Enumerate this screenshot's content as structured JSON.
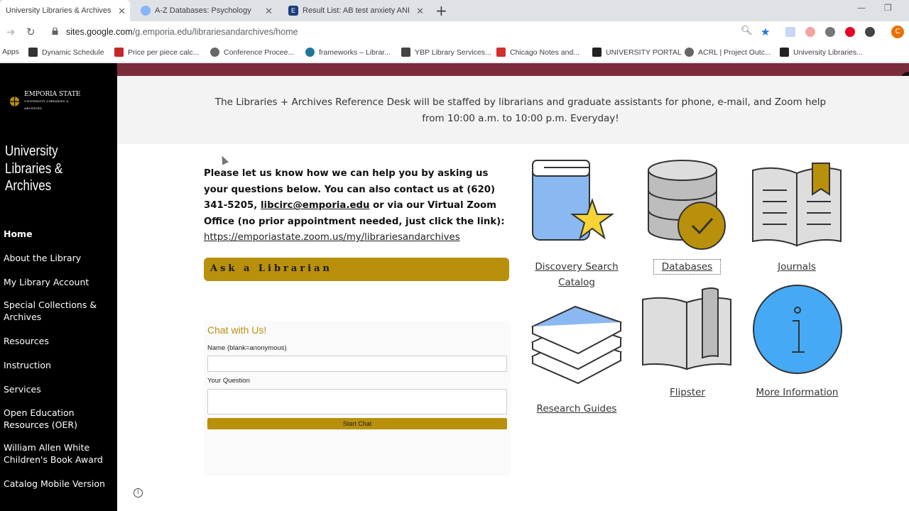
{
  "browser": {
    "tabs": [
      {
        "title": "University Libraries & Archives",
        "active": true
      },
      {
        "title": "A-Z Databases: Psychology",
        "active": false
      },
      {
        "title": "Result List: AB test anxiety AND ...",
        "active": false
      }
    ],
    "url_host": "sites.google.com",
    "url_path": "/g.emporia.edu/librariesandarchives/home",
    "profile_initial": "C",
    "bookmarks": [
      "Apps",
      "Dynamic Schedule",
      "Price per piece calc...",
      "Conference Procee...",
      "frameworks – Librar...",
      "YBP Library Services...",
      "Chicago Notes and...",
      "UNIVERSITY PORTAL",
      "ACRL | Project Outc...",
      "University Libraries..."
    ]
  },
  "sidebar": {
    "logo_main": "EMPORIA STATE",
    "logo_sub": "UNIVERSITY LIBRARIES & ARCHIVES",
    "site_title": "University Libraries & Archives",
    "items": [
      "Home",
      "About the Library",
      "My Library Account",
      "Special Collections & Archives",
      "Resources",
      "Instruction",
      "Services",
      "Open Education Resources (OER)",
      "William Allen White Children's Book Award",
      "Catalog Mobile Version"
    ]
  },
  "banner": {
    "text": "The Libraries + Archives Reference Desk will be staffed by librarians and graduate assistants for phone, e-mail, and Zoom help from 10:00 a.m. to 10:00 p.m. Everyday!"
  },
  "contact": {
    "text1": "Please let us know how we can help you by asking us your questions below. You can also contact us at (620) 341-5205,",
    "email": "libcirc@emporia.edu",
    "text2": "or via our Virtual Zoom Office (no prior appointment needed, just click the link):",
    "zoom_link": "https://emporiastate.zoom.us/my/librariesandarchives",
    "ask_button": "Ask a Librarian"
  },
  "chat": {
    "title": "Chat with Us!",
    "name_label": "Name (blank=anonymous)",
    "question_label": "Your Question",
    "start_button": "Start Chat"
  },
  "tiles": {
    "discovery": "Discovery Search Catalog",
    "databases": "Databases",
    "journals": "Journals",
    "research_guides": "Research Guides",
    "flipster": "Flipster",
    "more_info": "More Information"
  },
  "colors": {
    "gold": "#b8900c",
    "maroon": "#7b2c3a",
    "sidebar": "#000000"
  }
}
